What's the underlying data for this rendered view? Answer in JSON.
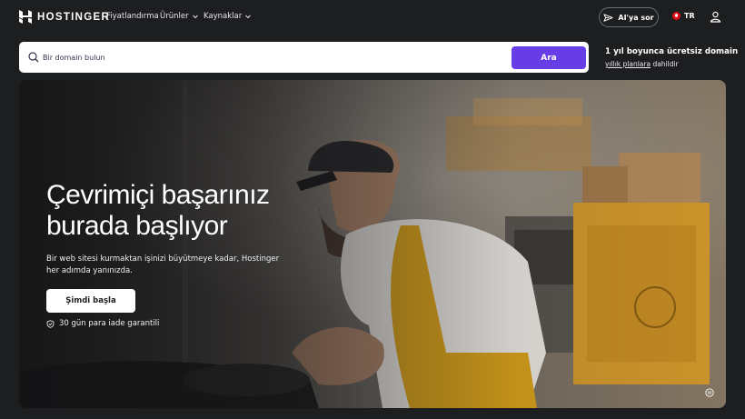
{
  "brand": {
    "name": "HOSTINGER"
  },
  "nav": {
    "items": [
      {
        "label": "Fiyatlandırma",
        "has_dropdown": false
      },
      {
        "label": "Ürünler",
        "has_dropdown": true
      },
      {
        "label": "Kaynaklar",
        "has_dropdown": true
      }
    ],
    "ai_button_label": "AI'ya sor",
    "language": "TR"
  },
  "search": {
    "placeholder": "Bir domain bulun",
    "value": "",
    "button_label": "Ara"
  },
  "promo": {
    "title": "1 yıl boyunca ücretsiz domain",
    "link_text": "yıllık planlara",
    "suffix": "dahildir"
  },
  "hero": {
    "title_line1": "Çevrimiçi başarınız",
    "title_line2": "burada başlıyor",
    "description": "Bir web sitesi kurmaktan işinizi büyütmeye kadar, Hostinger her adımda yanınızda.",
    "cta_label": "Şimdi başla",
    "guarantee": "30 gün para iade garantili"
  },
  "colors": {
    "background": "#1d1e20",
    "accent": "#673de6",
    "text": "#ffffff"
  },
  "icons": [
    "hostinger-logo",
    "chevron-down-icon",
    "sparkle-icon",
    "flag-tr-icon",
    "user-icon",
    "search-icon",
    "shield-check-icon",
    "pause-icon"
  ]
}
